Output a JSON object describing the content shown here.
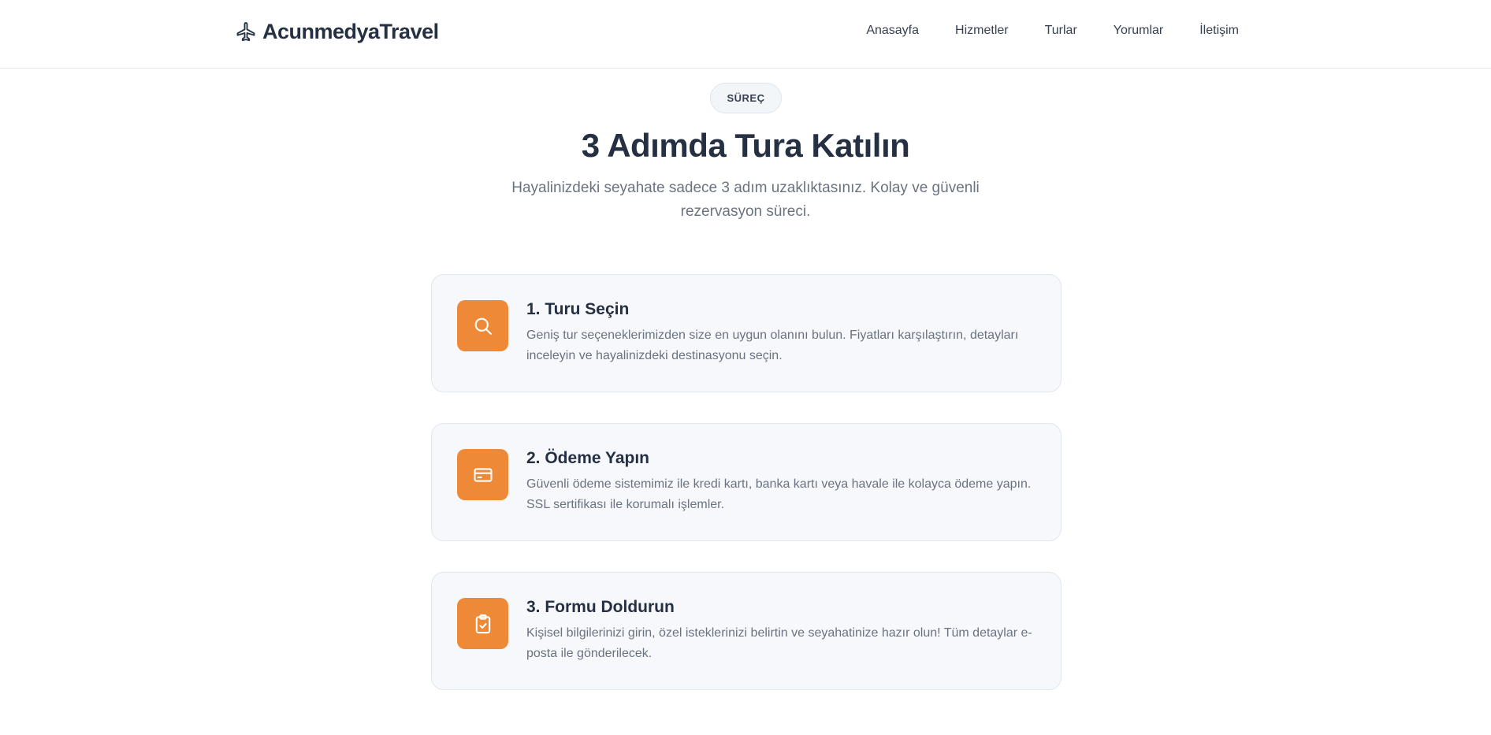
{
  "header": {
    "brand": "AcunmedyaTravel",
    "brand_icon": "plane-icon",
    "nav": [
      {
        "label": "Anasayfa"
      },
      {
        "label": "Hizmetler"
      },
      {
        "label": "Turlar"
      },
      {
        "label": "Yorumlar"
      },
      {
        "label": "İletişim"
      }
    ]
  },
  "section": {
    "badge": "SÜREÇ",
    "title": "3 Adımda Tura Katılın",
    "subtitle": "Hayalinizdeki seyahate sadece 3 adım uzaklıktasınız. Kolay ve güvenli rezervasyon süreci."
  },
  "steps": [
    {
      "icon": "search-icon",
      "title": "1. Turu Seçin",
      "description": "Geniş tur seçeneklerimizden size en uygun olanını bulun. Fiyatları karşılaştırın, detayları inceleyin ve hayalinizdeki destinasyonu seçin."
    },
    {
      "icon": "credit-card-icon",
      "title": "2. Ödeme Yapın",
      "description": "Güvenli ödeme sistemimiz ile kredi kartı, banka kartı veya havale ile kolayca ödeme yapın. SSL sertifikası ile korumalı işlemler."
    },
    {
      "icon": "clipboard-check-icon",
      "title": "3. Formu Doldurun",
      "description": "Kişisel bilgilerinizi girin, özel isteklerinizi belirtin ve seyahatinize hazır olun! Tüm detaylar e-posta ile gönderilecek."
    }
  ],
  "colors": {
    "accent": "#ee8a37",
    "heading": "#263043",
    "muted_text": "#6b7280",
    "card_bg": "#f6f8fb",
    "card_border": "#e1e7ef"
  }
}
